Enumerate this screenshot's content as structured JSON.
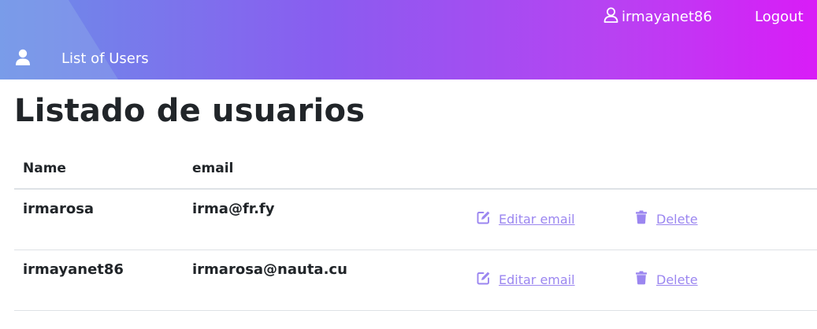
{
  "header": {
    "username": "irmayanet86",
    "logout_label": "Logout",
    "nav_title": "List of Users"
  },
  "main": {
    "title": "Listado de usuarios",
    "columns": {
      "name": "Name",
      "email": "email"
    },
    "rows": [
      {
        "name": "irmarosa",
        "email": "irma@fr.fy",
        "edit_label": "Editar email",
        "delete_label": "Delete"
      },
      {
        "name": "irmayanet86",
        "email": "irmarosa@nauta.cu",
        "edit_label": "Editar email",
        "delete_label": "Delete"
      }
    ]
  },
  "colors": {
    "accent": "#9b86f0",
    "gradient_start": "#6b8fe8",
    "gradient_end": "#d91cf7"
  },
  "icons": {
    "user": "user-icon",
    "edit": "edit-icon",
    "delete": "trash-icon"
  }
}
